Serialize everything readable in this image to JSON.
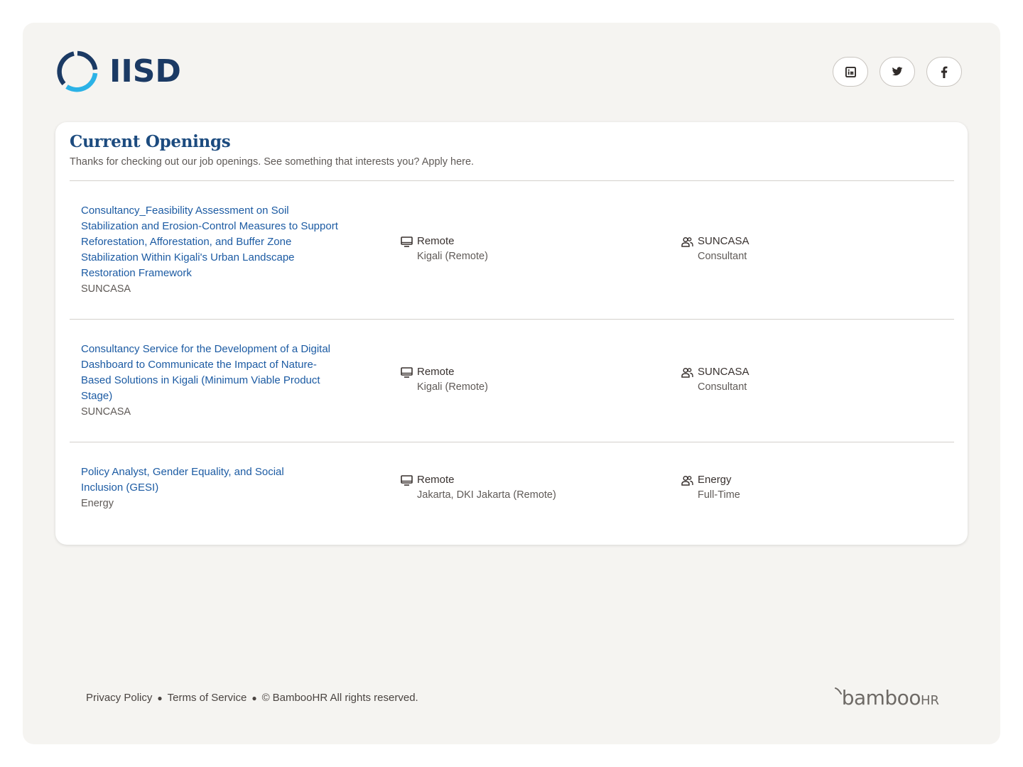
{
  "brand": {
    "logo_text": "IISD",
    "colors": {
      "navy": "#1b3a64",
      "cyan": "#2bb2e6",
      "link": "#1c5ba3"
    }
  },
  "social": [
    {
      "icon": "linkedin-icon"
    },
    {
      "icon": "twitter-icon"
    },
    {
      "icon": "facebook-icon"
    }
  ],
  "openings": {
    "title": "Current Openings",
    "subtitle": "Thanks for checking out our job openings. See something that interests you? Apply here.",
    "jobs": [
      {
        "title": "Consultancy_Feasibility Assessment on Soil Stabilization and Erosion-Control Measures to Support Reforestation, Afforestation, and Buffer Zone Stabilization Within Kigali's Urban Landscape Restoration Framework",
        "department": "SUNCASA",
        "location_type": "Remote",
        "location": "Kigali (Remote)",
        "team": "SUNCASA",
        "employment": "Consultant"
      },
      {
        "title": "Consultancy Service for the Development of a Digital Dashboard to Communicate the Impact of Nature-Based Solutions in Kigali (Minimum Viable Product Stage)",
        "department": "SUNCASA",
        "location_type": "Remote",
        "location": "Kigali (Remote)",
        "team": "SUNCASA",
        "employment": "Consultant"
      },
      {
        "title": "Policy Analyst, Gender Equality, and Social Inclusion (GESI)",
        "department": "Energy",
        "location_type": "Remote",
        "location": "Jakarta, DKI Jakarta (Remote)",
        "team": "Energy",
        "employment": "Full-Time"
      }
    ]
  },
  "footer": {
    "privacy": "Privacy Policy",
    "terms": "Terms of Service",
    "copyright": "BambooHR All rights reserved.",
    "powered_logo": "bamboo",
    "powered_logo_suffix": "HR"
  }
}
